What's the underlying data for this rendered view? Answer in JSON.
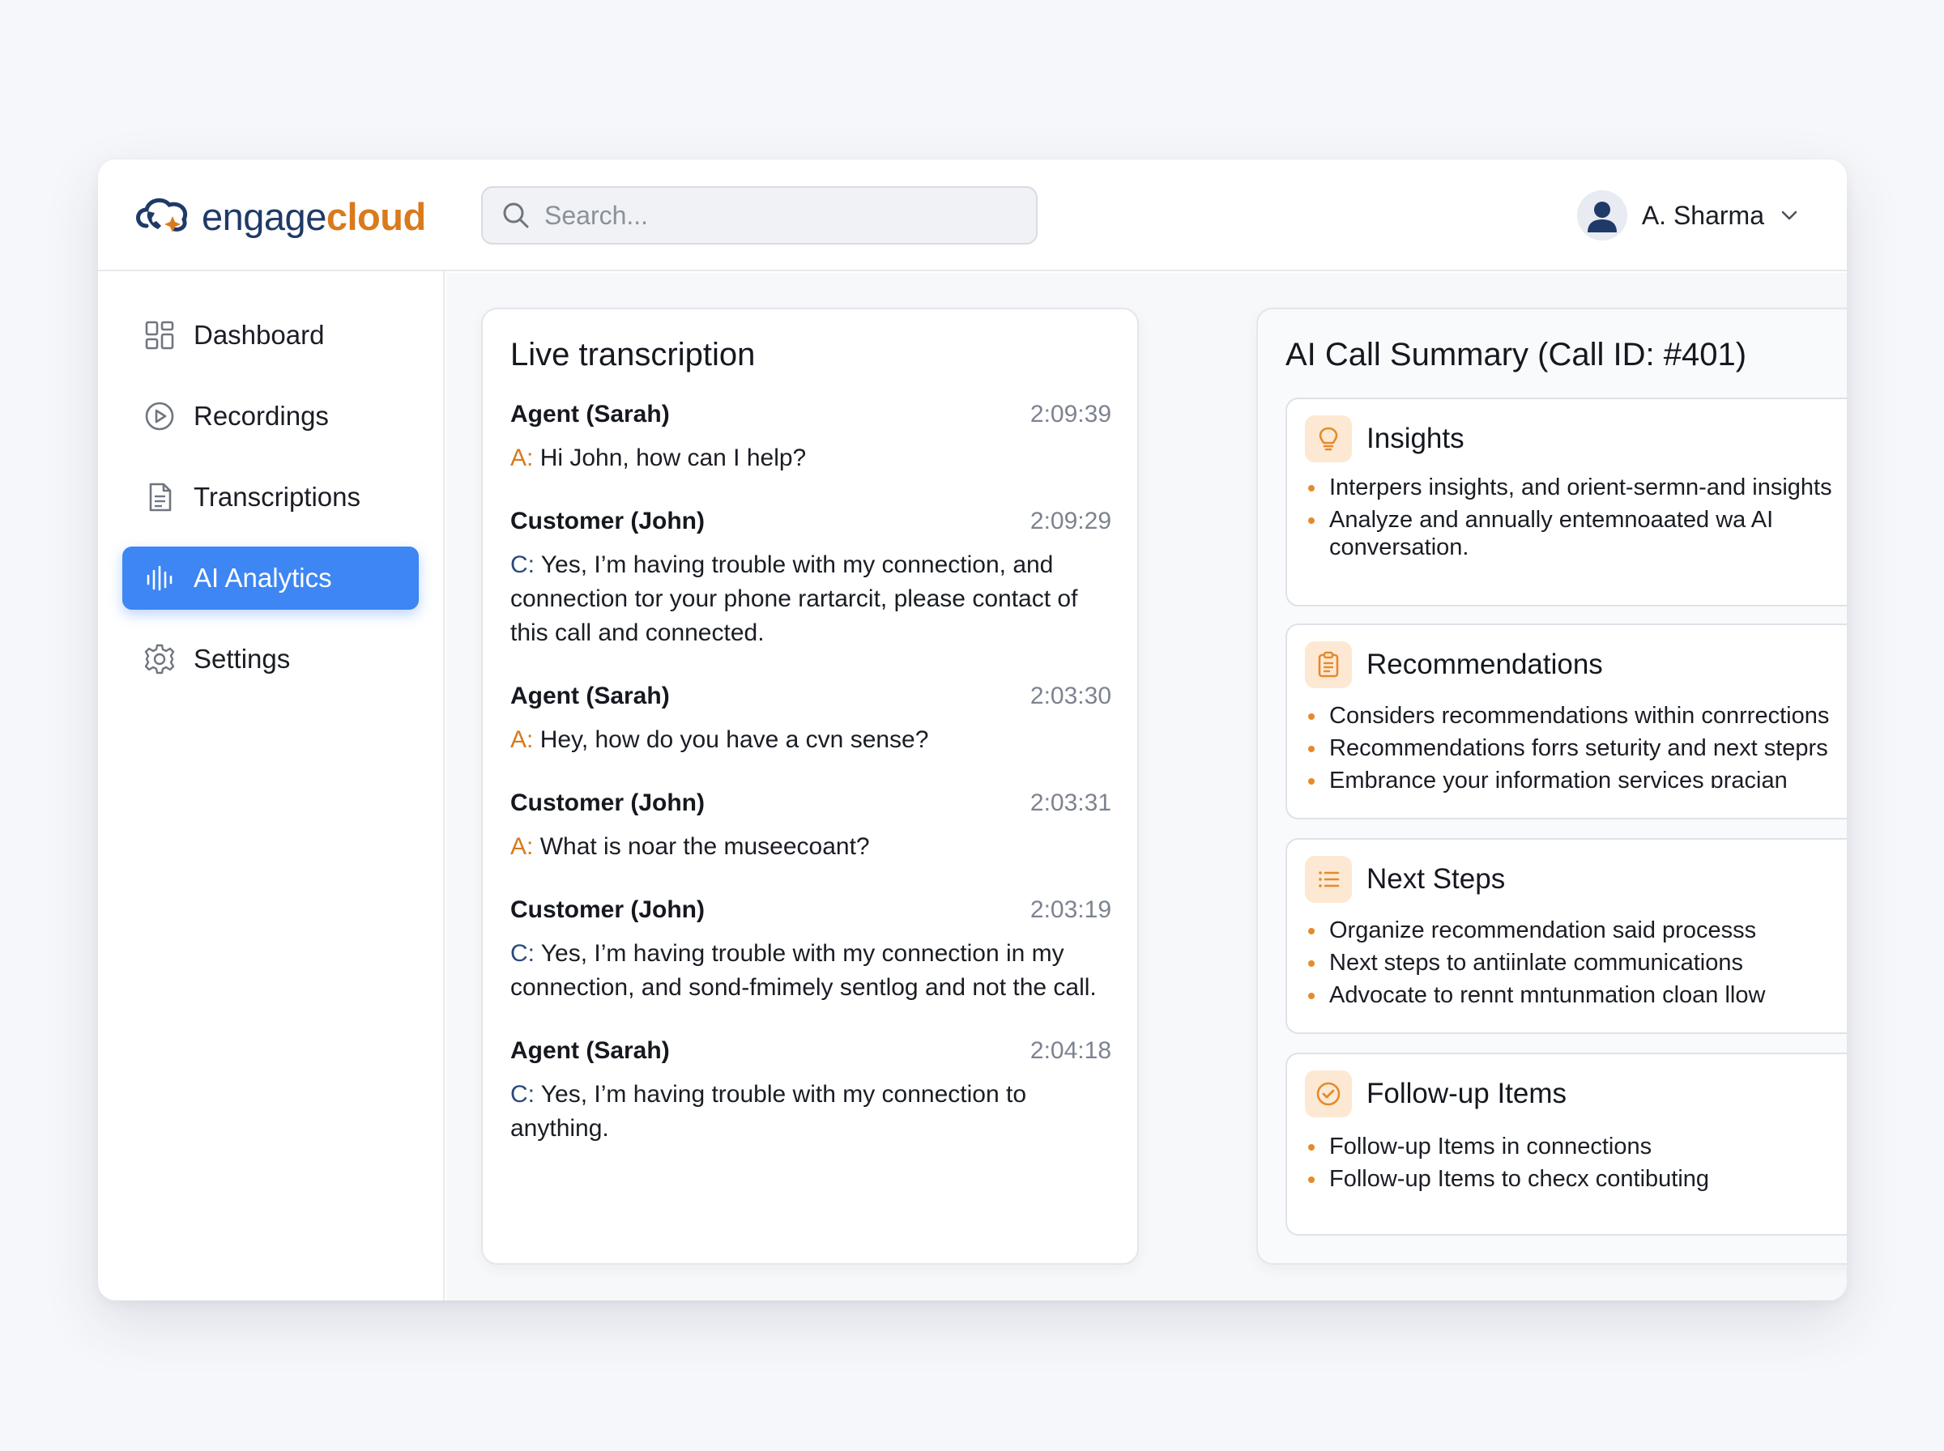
{
  "brand": {
    "name_part1": "engage",
    "name_part2": "cloud"
  },
  "search": {
    "placeholder": "Search..."
  },
  "user": {
    "name": "A. Sharma"
  },
  "sidebar": {
    "items": [
      {
        "label": "Dashboard",
        "icon": "grid-icon",
        "active": false
      },
      {
        "label": "Recordings",
        "icon": "play-circle-icon",
        "active": false
      },
      {
        "label": "Transcriptions",
        "icon": "document-icon",
        "active": false
      },
      {
        "label": "AI Analytics",
        "icon": "sound-bars-icon",
        "active": true
      },
      {
        "label": "Settings",
        "icon": "gear-icon",
        "active": false
      }
    ]
  },
  "transcription": {
    "title": "Live transcription",
    "messages": [
      {
        "speaker": "Agent (Sarah)",
        "time": "2:09:39",
        "prefix": "A:",
        "text": " Hi John, how can I help?"
      },
      {
        "speaker": "Customer (John)",
        "time": "2:09:29",
        "prefix": "C:",
        "text": " Yes, I’m having trouble with my connection, and connection tor your phone rartarcit, please contact of this call and connected."
      },
      {
        "speaker": "Agent (Sarah)",
        "time": "2:03:30",
        "prefix": "A:",
        "text": " Hey, how do you have a cvn sense?"
      },
      {
        "speaker": "Customer (John)",
        "time": "2:03:31",
        "prefix": "A:",
        "text": " What is noar the museecoant?"
      },
      {
        "speaker": "Customer (John)",
        "time": "2:03:19",
        "prefix": "C:",
        "text": " Yes, I’m having trouble with my connection in my connection, and sond-fmimely sentlog and not the call."
      },
      {
        "speaker": "Agent (Sarah)",
        "time": "2:04:18",
        "prefix": "C:",
        "text": " Yes, I’m having trouble with my connection to anything."
      }
    ]
  },
  "summary": {
    "title": "AI Call Summary (Call ID: #401)",
    "sections": [
      {
        "title": "Insights",
        "icon": "lightbulb-icon",
        "items": [
          "Interpers insights, and orient-sermn-and insights",
          "Analyze and annually entemnoaated wa AI conversation."
        ]
      },
      {
        "title": "Recommendations",
        "icon": "clipboard-icon",
        "items": [
          "Considers recommendations within conrrections",
          "Recommendations forrs seturity and next steprs",
          "Embrance your information services ɒracian"
        ]
      },
      {
        "title": "Next Steps",
        "icon": "list-icon",
        "items": [
          "Organize recommendation said processs",
          "Next steps to antiinlate communications",
          "Advocate to rennt mntunmation cloan llow"
        ]
      },
      {
        "title": "Follow-up Items",
        "icon": "check-circle-icon",
        "items": [
          "Follow-up Items in connections",
          "Follow-up Items to checx contibuting"
        ]
      }
    ]
  },
  "colors": {
    "accent": "#3d86f3",
    "brand_orange": "#d97a1c",
    "brand_navy": "#1f3a68"
  }
}
